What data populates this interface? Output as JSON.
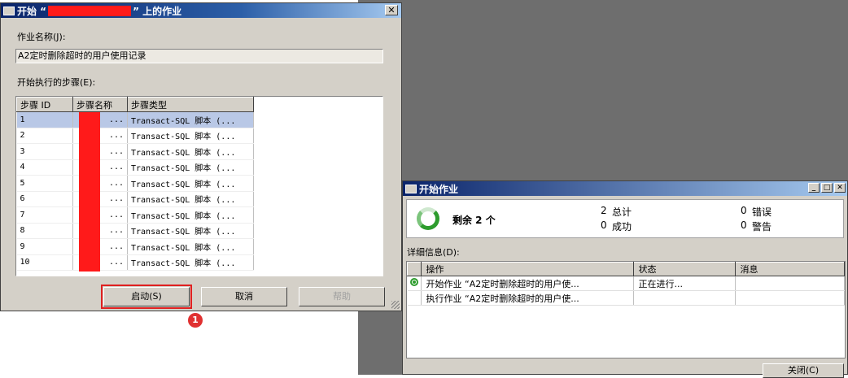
{
  "start_job_dialog": {
    "title_prefix": "开始 “",
    "title_suffix": "” 上的作业",
    "close_glyph": "✕",
    "job_name_label": "作业名称(J):",
    "job_name_value": "A2定时删除超时的用户使用记录",
    "steps_label": "开始执行的步骤(E):",
    "columns": [
      "步骤 ID",
      "步骤名称",
      "步骤类型"
    ],
    "rows": [
      {
        "id": "1",
        "name": "...",
        "type": "Transact-SQL 脚本 (..."
      },
      {
        "id": "2",
        "name": "...",
        "type": "Transact-SQL 脚本 (..."
      },
      {
        "id": "3",
        "name": "...",
        "type": "Transact-SQL 脚本 (..."
      },
      {
        "id": "4",
        "name": "...",
        "type": "Transact-SQL 脚本 (..."
      },
      {
        "id": "5",
        "name": "...",
        "type": "Transact-SQL 脚本 (..."
      },
      {
        "id": "6",
        "name": "...",
        "type": "Transact-SQL 脚本 (..."
      },
      {
        "id": "7",
        "name": "...",
        "type": "Transact-SQL 脚本 (..."
      },
      {
        "id": "8",
        "name": "...",
        "type": "Transact-SQL 脚本 (..."
      },
      {
        "id": "9",
        "name": "...",
        "type": "Transact-SQL 脚本 (..."
      },
      {
        "id": "10",
        "name": "...",
        "type": "Transact-SQL 脚本 (..."
      }
    ],
    "start_button": "启动(S)",
    "cancel_button": "取消",
    "help_button": "帮助",
    "annotation_badge": "1"
  },
  "progress_dialog": {
    "title": "开始作业",
    "status_main": "剩余 2 个",
    "total_count": "2",
    "total_label": "总计",
    "success_count": "0",
    "success_label": "成功",
    "error_count": "0",
    "error_label": "错误",
    "warning_count": "0",
    "warning_label": "警告",
    "details_label": "详细信息(D):",
    "columns": [
      "操作",
      "状态",
      "消息"
    ],
    "rows": [
      {
        "action": "开始作业 “A2定时删除超时的用户使...",
        "status": "正在进行...",
        "message": ""
      },
      {
        "action": "执行作业 “A2定时删除超时的用户使...",
        "status": "",
        "message": ""
      }
    ],
    "close_button": "关闭(C)"
  },
  "colors": {
    "titlebar": "#0a246a",
    "highlight_red": "#e02020",
    "progress_green": "#2d9c2d"
  }
}
